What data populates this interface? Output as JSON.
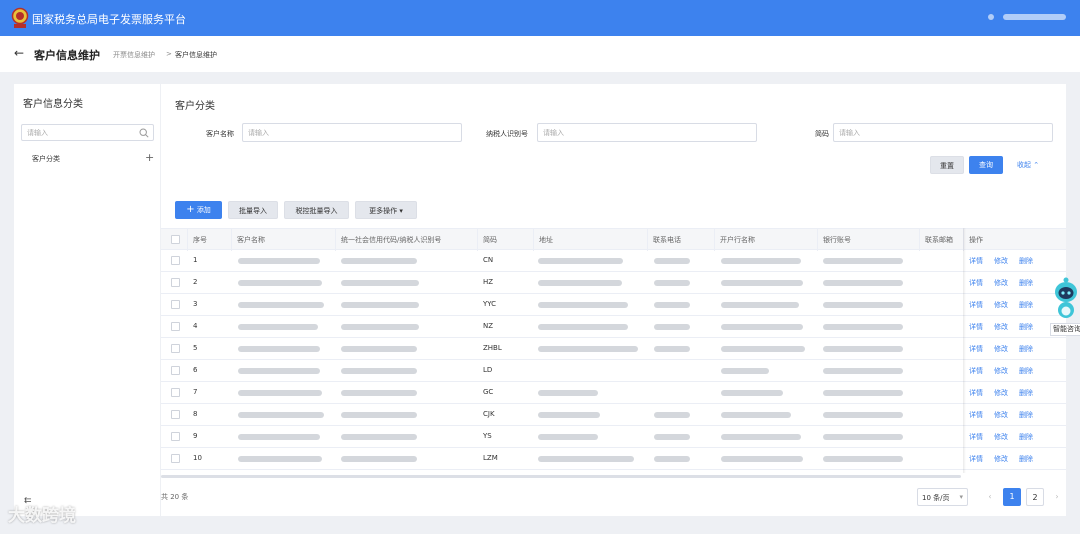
{
  "topbar": {
    "title": "国家税务总局电子发票服务平台"
  },
  "header": {
    "back": "←",
    "title": "客户信息维护",
    "breadcrumb": [
      "开票信息维护",
      ">",
      "客户信息维护"
    ]
  },
  "sidebar": {
    "title": "客户信息分类",
    "search_placeholder": "请输入",
    "tree_items": [
      "客户分类"
    ],
    "add_symbol": "+",
    "collapse_symbol": "⇇"
  },
  "main": {
    "title": "客户分类",
    "filters": [
      {
        "label": "客户名称",
        "placeholder": "请输入"
      },
      {
        "label": "纳税人识别号",
        "placeholder": "请输入"
      },
      {
        "label": "简码",
        "placeholder": "请输入"
      }
    ],
    "reset_label": "重置",
    "query_label": "查询",
    "collapse_label": "收起 ⌃",
    "actions": {
      "add": "添加",
      "batch_import": "批量导入",
      "tax_batch_import": "税控批量导入",
      "more": "更多操作 ▾"
    },
    "table": {
      "columns": [
        "序号",
        "客户名称",
        "统一社会信用代码/纳税人识别号",
        "简码",
        "地址",
        "联系电话",
        "开户行名称",
        "银行账号",
        "联系邮箱",
        "操作"
      ],
      "rows": [
        {
          "no": "1",
          "code": "CN"
        },
        {
          "no": "2",
          "code": "HZ"
        },
        {
          "no": "3",
          "code": "YYC"
        },
        {
          "no": "4",
          "code": "NZ"
        },
        {
          "no": "5",
          "code": "ZHBL"
        },
        {
          "no": "6",
          "code": "LD"
        },
        {
          "no": "7",
          "code": "GC"
        },
        {
          "no": "8",
          "code": "CJK"
        },
        {
          "no": "9",
          "code": "YS"
        },
        {
          "no": "10",
          "code": "LZM"
        }
      ],
      "row_actions": [
        "详情",
        "修改",
        "删除"
      ]
    },
    "pagination": {
      "total": "共 20 条",
      "page_size": "10 条/页",
      "pages": [
        "1",
        "2"
      ],
      "prev": "‹",
      "next": "›"
    }
  },
  "assistant": {
    "label": "智能咨询"
  },
  "watermark": {
    "text": "大数跨境"
  }
}
